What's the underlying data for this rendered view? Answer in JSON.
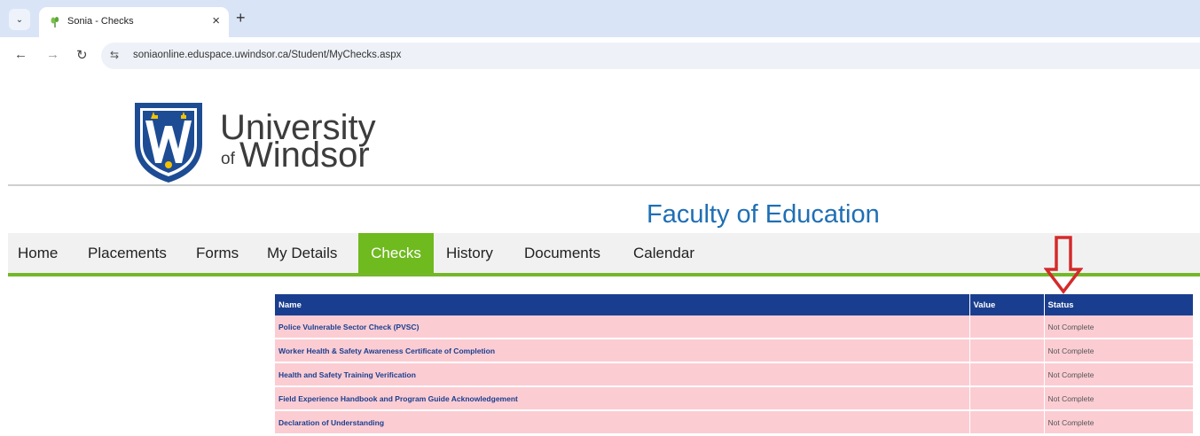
{
  "browser": {
    "tab_title": "Sonia - Checks",
    "tab_close": "×",
    "new_tab": "+",
    "dropdown": "⌄",
    "url": "soniaonline.eduspace.uwindsor.ca/Student/MyChecks.aspx",
    "back": "←",
    "forward": "→",
    "reload": "↻",
    "site_info": "⇆"
  },
  "header": {
    "university_line1": "University",
    "university_of": "of",
    "university_line2": "Windsor",
    "faculty": "Faculty of Education"
  },
  "menu": {
    "items": [
      {
        "label": "Home"
      },
      {
        "label": "Placements"
      },
      {
        "label": "Forms"
      },
      {
        "label": "My Details"
      },
      {
        "label": "Checks"
      },
      {
        "label": "History"
      },
      {
        "label": "Documents"
      },
      {
        "label": "Calendar"
      }
    ],
    "active": "Checks"
  },
  "checks_table": {
    "columns": [
      "Name",
      "Value",
      "Status"
    ],
    "rows": [
      {
        "name": "Police Vulnerable Sector Check (PVSC)",
        "value": "",
        "status": "Not Complete"
      },
      {
        "name": "Worker Health & Safety Awareness Certificate of Completion",
        "value": "",
        "status": "Not Complete"
      },
      {
        "name": "Health and Safety Training Verification",
        "value": "",
        "status": "Not Complete"
      },
      {
        "name": "Field Experience Handbook and Program Guide Acknowledgement",
        "value": "",
        "status": "Not Complete"
      },
      {
        "name": "Declaration of Understanding",
        "value": "",
        "status": "Not Complete"
      }
    ]
  },
  "colors": {
    "header_bg": "#1a3e8f",
    "row_bg": "#fbcdd3",
    "menu_active": "#6fba1f",
    "faculty_text": "#1f6fb5",
    "annotation_arrow": "#d42a2a"
  },
  "icons": {
    "annotation": "red-down-arrow-icon",
    "logo": "uwindsor-shield-icon",
    "favicon": "sonia-leaf-icon"
  }
}
